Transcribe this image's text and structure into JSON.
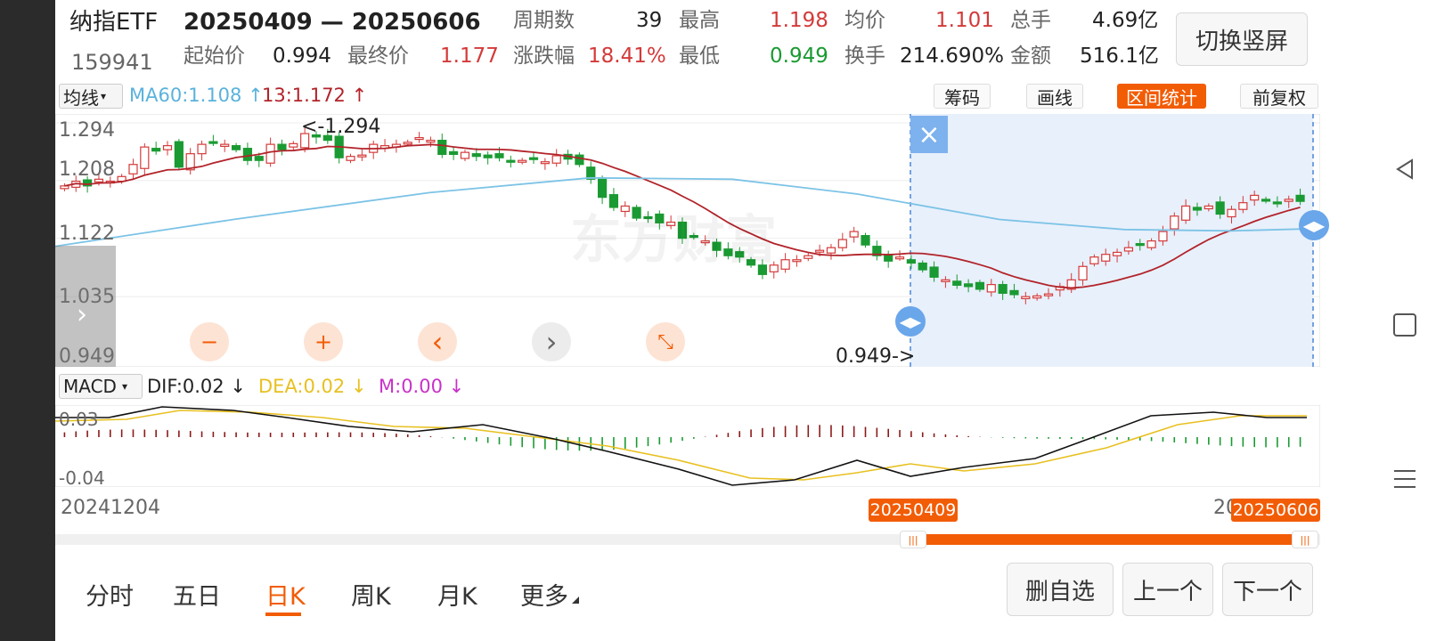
{
  "header": {
    "name": "纳指ETF",
    "code": "159941",
    "range": "20250409 — 20250606",
    "stats": {
      "start_label": "起始价",
      "start_value": "0.994",
      "end_label": "最终价",
      "end_value": "1.177",
      "period_label": "周期数",
      "period_value": "39",
      "change_label": "涨跌幅",
      "change_value": "18.41%",
      "high_label": "最高",
      "high_value": "1.198",
      "low_label": "最低",
      "low_value": "0.949",
      "avg_label": "均价",
      "avg_value": "1.101",
      "turnover_label": "换手",
      "turnover_value": "214.690%",
      "volume_label": "总手",
      "volume_value": "4.69亿",
      "amount_label": "金额",
      "amount_value": "516.1亿"
    },
    "switch_button": "切换竖屏"
  },
  "toolbar": {
    "ma_selector": "均线",
    "ma60_label": "MA60:1.108",
    "ma13_label": "13:1.172",
    "chips": "筹码",
    "draw": "画线",
    "range_stat": "区间统计",
    "adjust": "前复权"
  },
  "price_chart": {
    "y_ticks": [
      "1.294",
      "1.208",
      "1.122",
      "1.035",
      "0.949"
    ],
    "high_marker": "<-1.294",
    "low_marker": "0.949->",
    "watermark": "东方财富",
    "close_icon": "×"
  },
  "macd": {
    "selector": "MACD",
    "dif": "DIF:0.02",
    "dea": "DEA:0.02",
    "m": "M:0.00",
    "y_top": "0.03",
    "y_bottom": "-0.04"
  },
  "timeline": {
    "start_date": "20241204",
    "range_start": "20250409",
    "range_end": "20250606",
    "end_date_partial": "20"
  },
  "controls": {
    "minus": "−",
    "plus": "+",
    "prev": "‹",
    "next": "›",
    "shrink": "⤡"
  },
  "tabs": [
    "分时",
    "五日",
    "日K",
    "周K",
    "月K",
    "更多"
  ],
  "bottom_buttons": {
    "remove": "删自选",
    "prev": "上一个",
    "next": "下一个"
  },
  "colors": {
    "up": "#d43a3a",
    "down": "#1a9a32",
    "ma60": "#7cc3e6",
    "ma13": "#b2232a",
    "accent": "#f25c05",
    "dea": "#e8c020",
    "m": "#c832c8",
    "selection": "#e8f0fb"
  },
  "chart_data": {
    "type": "candlestick",
    "ylim": [
      0.949,
      1.294
    ],
    "series": [
      {
        "values": [
          1.2,
          1.207,
          1.2,
          1.21,
          1.207,
          1.214,
          1.232,
          1.258,
          1.252,
          1.26,
          1.228,
          1.248,
          1.262,
          1.265,
          1.262,
          1.254,
          1.238,
          1.238,
          1.262,
          1.254,
          1.263,
          1.278,
          1.273,
          1.268,
          1.242,
          1.244,
          1.246,
          1.262,
          1.26,
          1.262,
          1.265,
          1.272,
          1.268,
          1.247,
          1.247,
          1.25,
          1.244,
          1.242,
          1.242,
          1.236,
          1.238,
          1.24,
          1.236,
          1.245,
          1.24,
          1.232,
          1.21,
          1.183,
          1.168,
          1.17,
          1.152,
          1.152,
          1.145,
          1.146,
          1.122,
          1.124,
          1.118,
          1.104,
          1.096,
          1.094,
          1.082,
          1.068,
          1.082,
          1.09,
          1.09,
          1.096,
          1.104,
          1.108,
          1.12,
          1.132,
          1.112,
          1.096,
          1.088,
          1.094,
          1.085,
          1.075,
          1.064,
          1.06,
          1.052,
          1.05,
          1.046,
          1.053,
          1.04,
          1.038,
          1.035,
          1.036,
          1.039,
          1.05,
          1.06,
          1.08,
          1.094,
          1.098,
          1.101,
          1.108,
          1.112,
          1.118,
          1.132,
          1.155,
          1.17,
          1.164,
          1.17,
          1.158,
          1.165,
          1.175,
          1.186,
          1.178,
          1.175,
          1.18,
          1.177
        ]
      }
    ]
  }
}
